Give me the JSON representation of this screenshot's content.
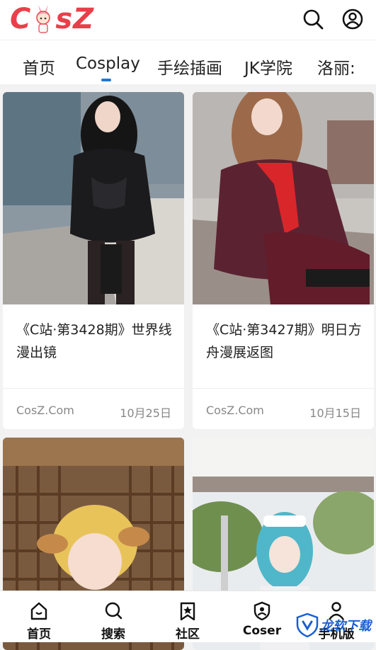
{
  "header": {
    "logo_text_left": "C",
    "logo_text_right": "sZ",
    "brand_color": "#e8404a",
    "search_icon": "search-icon",
    "user_icon": "user-circle-icon"
  },
  "tabs": {
    "items": [
      {
        "label": "首页"
      },
      {
        "label": "Cosplay"
      },
      {
        "label": "手绘插画"
      },
      {
        "label": "JK学院"
      },
      {
        "label": "洛丽:"
      }
    ],
    "active_index": 1,
    "accent": "#1f78d1"
  },
  "cards": [
    {
      "title": "《C站·第3428期》世界线漫出镜",
      "site": "CosZ.Com",
      "date": "10月25日"
    },
    {
      "title": "《C站·第3427期》明日方舟漫展返图",
      "site": "CosZ.Com",
      "date": "10月15日"
    },
    {
      "title": "",
      "site": "",
      "date": ""
    },
    {
      "title": "",
      "site": "",
      "date": ""
    }
  ],
  "bottom_nav": {
    "items": [
      {
        "label": "首页",
        "icon": "home-icon"
      },
      {
        "label": "搜索",
        "icon": "search-icon"
      },
      {
        "label": "社区",
        "icon": "bookmark-star-icon"
      },
      {
        "label": "Coser",
        "icon": "shield-user-icon"
      },
      {
        "label": "手机版",
        "icon": "user-icon"
      }
    ]
  },
  "watermark": {
    "text": "龙软下载"
  }
}
